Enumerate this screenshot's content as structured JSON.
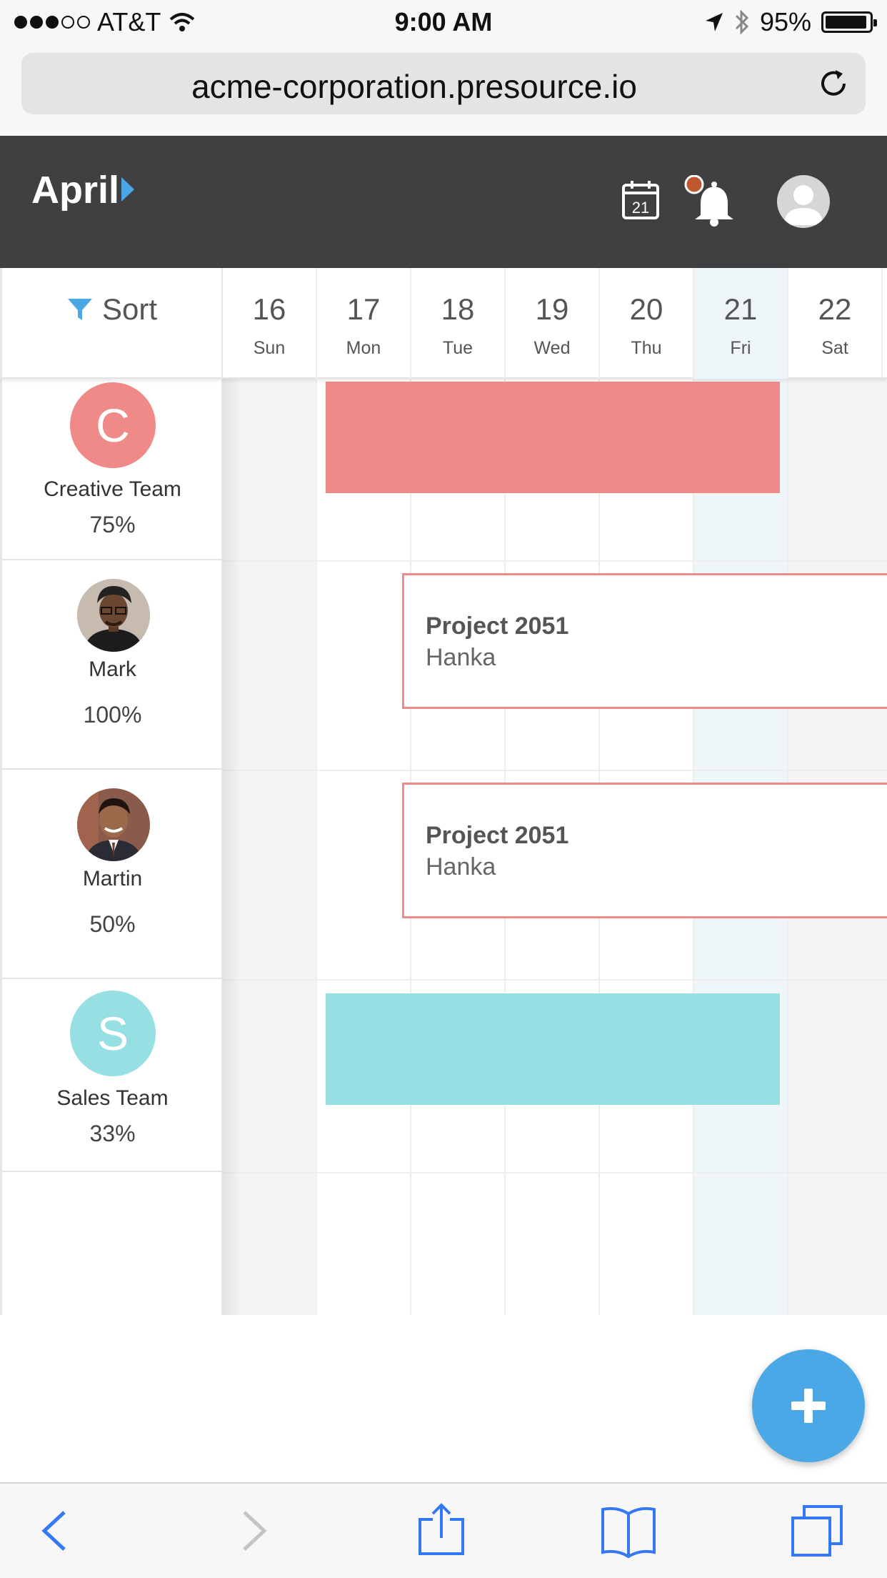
{
  "status_bar": {
    "carrier": "AT&T",
    "time": "9:00 AM",
    "battery": "95%",
    "battery_level": 0.95
  },
  "browser": {
    "url": "acme-corporation.presource.io"
  },
  "header": {
    "month": "April"
  },
  "calendar": {
    "icon_day": "21"
  },
  "sort": {
    "label": "Sort"
  },
  "days": [
    {
      "num": "16",
      "name": "Sun"
    },
    {
      "num": "17",
      "name": "Mon"
    },
    {
      "num": "18",
      "name": "Tue"
    },
    {
      "num": "19",
      "name": "Wed"
    },
    {
      "num": "20",
      "name": "Thu"
    },
    {
      "num": "21",
      "name": "Fri"
    },
    {
      "num": "22",
      "name": "Sat"
    }
  ],
  "resources": [
    {
      "name": "Creative Team",
      "pct": "75%",
      "initial": "C",
      "color": "#ef8a88"
    },
    {
      "name": "Mark",
      "pct": "100%"
    },
    {
      "name": "Martin",
      "pct": "50%"
    },
    {
      "name": "Sales Team",
      "pct": "33%",
      "initial": "S",
      "color": "#96dfe2"
    }
  ],
  "bookings": [
    {
      "project": "Project 2051",
      "client": "Hanka"
    },
    {
      "project": "Project 2051",
      "client": "Hanka"
    }
  ],
  "colors": {
    "header_bg": "#404042",
    "accent_blue": "#4aa8e6",
    "today_bg": "#eef6fa",
    "booking_border": "#ee8a8a",
    "notification_dot": "#c0582e"
  }
}
